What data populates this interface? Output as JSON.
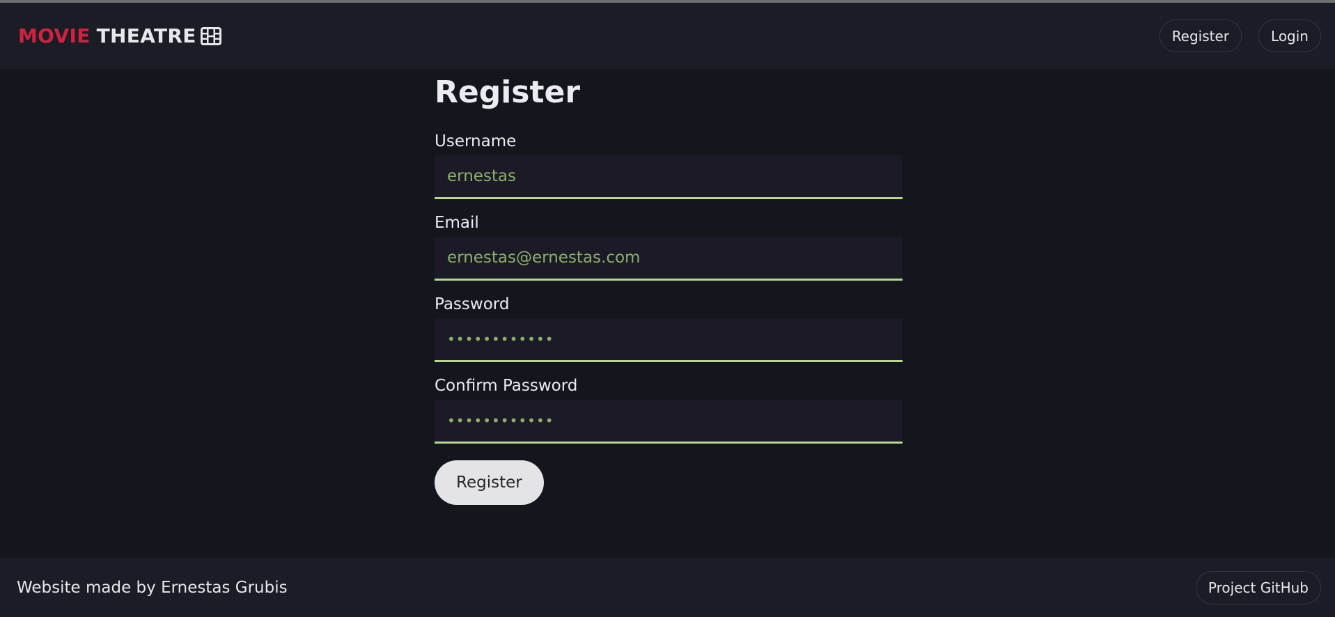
{
  "brand": {
    "word1": "MOVIE",
    "word2": "THEATRE",
    "icon": "film-icon",
    "accent_color": "#d2213f"
  },
  "nav": {
    "register_label": "Register",
    "login_label": "Login"
  },
  "form": {
    "title": "Register",
    "fields": [
      {
        "label": "Username",
        "value": "ernestas"
      },
      {
        "label": "Email",
        "value": "ernestas@ernestas.com"
      },
      {
        "label": "Password",
        "value": "••••••••••••"
      },
      {
        "label": "Confirm Password",
        "value": "••••••••••••"
      }
    ],
    "submit_label": "Register",
    "input_underline_color": "#b5d98e",
    "input_text_color": "#8ab06a"
  },
  "footer": {
    "credit": "Website made by Ernestas Grubis",
    "github_label": "Project GitHub"
  }
}
